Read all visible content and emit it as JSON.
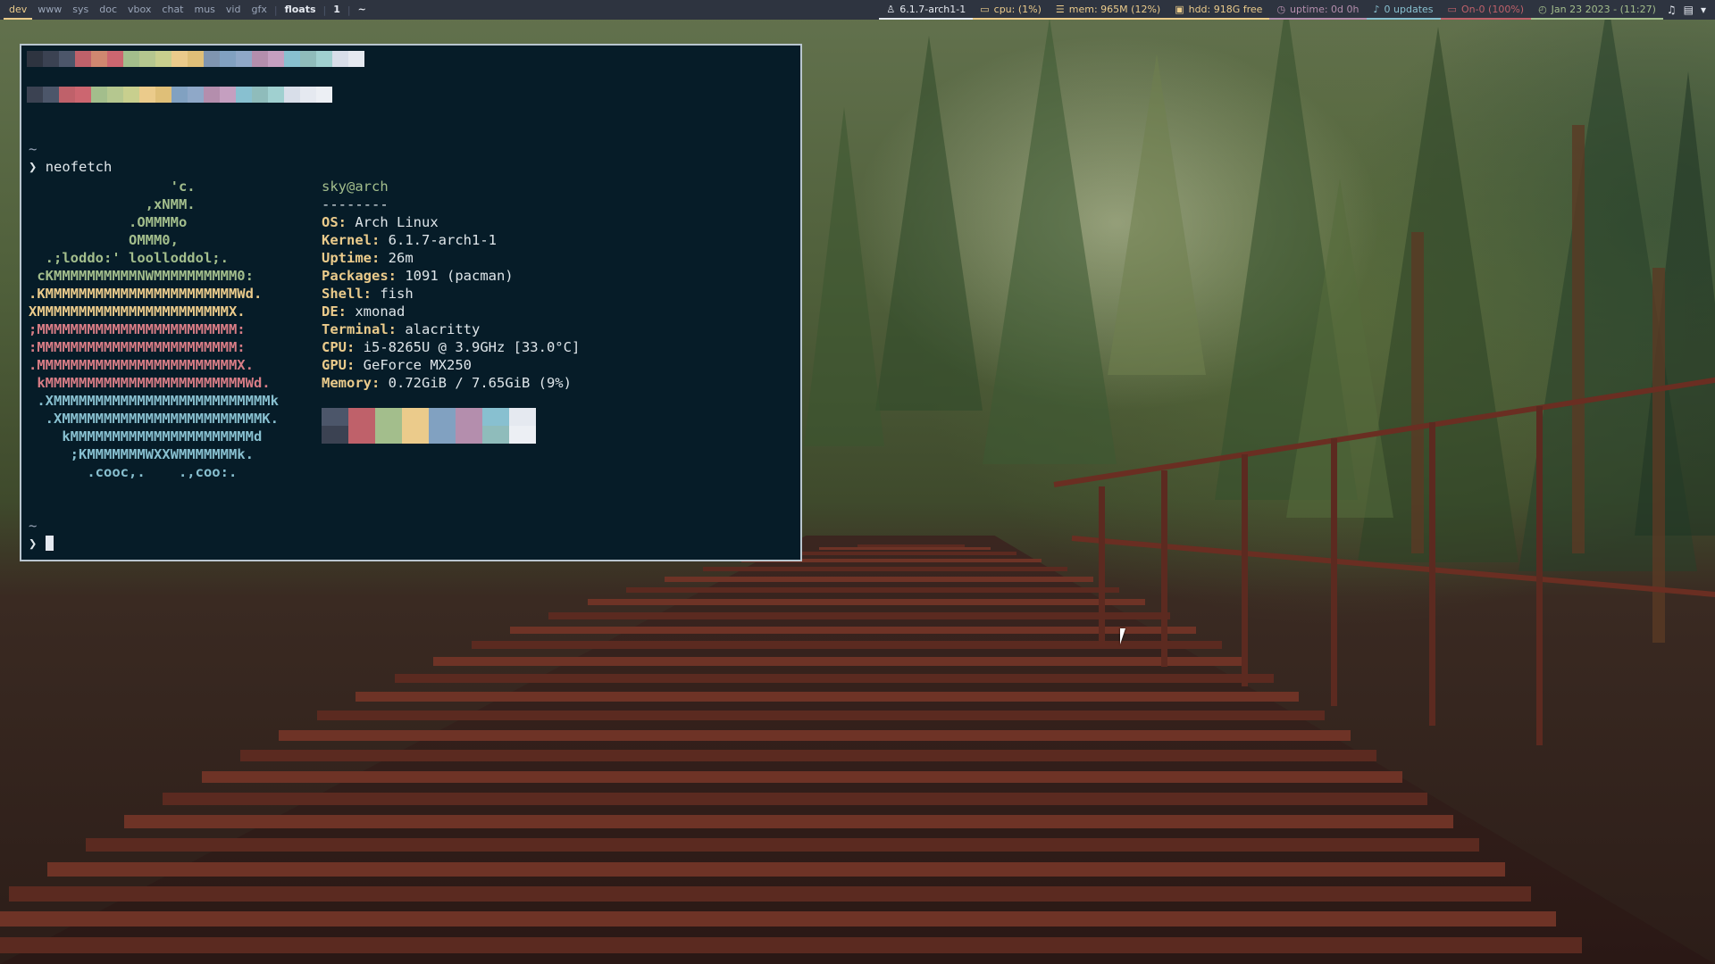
{
  "topbar": {
    "workspaces": [
      {
        "label": "dev",
        "state": "active"
      },
      {
        "label": "www",
        "state": "normal"
      },
      {
        "label": "sys",
        "state": "normal"
      },
      {
        "label": "doc",
        "state": "normal"
      },
      {
        "label": "vbox",
        "state": "normal"
      },
      {
        "label": "chat",
        "state": "normal"
      },
      {
        "label": "mus",
        "state": "normal"
      },
      {
        "label": "vid",
        "state": "normal"
      },
      {
        "label": "gfx",
        "state": "normal"
      }
    ],
    "layout": "floats",
    "window_count": "1",
    "title": "~",
    "status": [
      {
        "name": "kernel",
        "icon": "linux-icon",
        "glyph": "♙",
        "text": "6.1.7-arch1-1",
        "color": "#e5e9f0"
      },
      {
        "name": "cpu",
        "icon": "monitor-icon",
        "glyph": "▭",
        "text": "cpu: (1%)",
        "color": "#ebcb8b"
      },
      {
        "name": "mem",
        "icon": "memory-icon",
        "glyph": "☰",
        "text": "mem: 965M (12%)",
        "color": "#ebcb8b"
      },
      {
        "name": "hdd",
        "icon": "disk-icon",
        "glyph": "▣",
        "text": "hdd: 918G free",
        "color": "#ebcb8b"
      },
      {
        "name": "uptime",
        "icon": "uptime-icon",
        "glyph": "◷",
        "text": "uptime: 0d 0h",
        "color": "#b48ead"
      },
      {
        "name": "updates",
        "icon": "bell-icon",
        "glyph": "♪",
        "text": "0 updates",
        "color": "#88c0d0"
      },
      {
        "name": "battery",
        "icon": "battery-icon",
        "glyph": "▭",
        "text": "On-0 (100%)",
        "color": "#bf616a"
      },
      {
        "name": "clock",
        "icon": "clock-icon",
        "glyph": "◴",
        "text": "Jan 23 2023 - (11:27)",
        "color": "#a3be8c"
      }
    ],
    "tray": [
      {
        "name": "volume-icon",
        "glyph": "♫"
      },
      {
        "name": "clipboard-icon",
        "glyph": "▤"
      },
      {
        "name": "network-icon",
        "glyph": "▾"
      }
    ]
  },
  "terminal": {
    "colors_top": [
      "#2e3440",
      "#3b4252",
      "#4c566a",
      "#bf616a",
      "#d08770",
      "#cc6670",
      "#a3be8c",
      "#b5c78f",
      "#c8cf8e",
      "#ebcb8b",
      "#dfbf78",
      "#7f95b0",
      "#81a1c1",
      "#8fa8c8",
      "#b48ead",
      "#c59fc0",
      "#88c0d0",
      "#8fbcbb",
      "#a0d0d0",
      "#d8dee9",
      "#e5e9f0"
    ],
    "colors_bottom": [
      "#3b4252",
      "#4c566a",
      "#bf616a",
      "#cc6670",
      "#a3be8c",
      "#b5c78f",
      "#c8cf8e",
      "#ebcb8b",
      "#dfbf78",
      "#81a1c1",
      "#8fa8c8",
      "#b48ead",
      "#c59fc0",
      "#88c0d0",
      "#8fbcbb",
      "#a0d0d0",
      "#d8dee9",
      "#e5e9f0",
      "#eceff4"
    ],
    "prompt_dir_1": "~",
    "prompt_symbol": "❯",
    "command": "neofetch",
    "ascii": [
      {
        "text": "                 'c.",
        "cls": "a1"
      },
      {
        "text": "              ,xNMM.",
        "cls": "a1"
      },
      {
        "text": "            .OMMMMo",
        "cls": "a1"
      },
      {
        "text": "            OMMM0,",
        "cls": "a1"
      },
      {
        "text": "  .;loddo:' loolloddol;.",
        "cls": "a1"
      },
      {
        "text": " cKMMMMMMMMMMNWMMMMMMMMMM0:",
        "cls": "a1"
      },
      {
        "text": ".KMMMMMMMMMMMMMMMMMMMMMMMWd.",
        "cls": "a2"
      },
      {
        "text": "XMMMMMMMMMMMMMMMMMMMMMMMX.",
        "cls": "a2"
      },
      {
        "text": ";MMMMMMMMMMMMMMMMMMMMMMMM:",
        "cls": "a3"
      },
      {
        "text": ":MMMMMMMMMMMMMMMMMMMMMMMM:",
        "cls": "a3"
      },
      {
        "text": ".MMMMMMMMMMMMMMMMMMMMMMMMX.",
        "cls": "a3"
      },
      {
        "text": " kMMMMMMMMMMMMMMMMMMMMMMMMWd.",
        "cls": "a3"
      },
      {
        "text": " .XMMMMMMMMMMMMMMMMMMMMMMMMMMk",
        "cls": "a4"
      },
      {
        "text": "  .XMMMMMMMMMMMMMMMMMMMMMMMMK.",
        "cls": "a4"
      },
      {
        "text": "    kMMMMMMMMMMMMMMMMMMMMMMd",
        "cls": "a4"
      },
      {
        "text": "     ;KMMMMMMMWXXWMMMMMMMk.",
        "cls": "a4"
      },
      {
        "text": "       .cooc,.    .,coo:.",
        "cls": "a4"
      }
    ],
    "user_host": "sky@arch",
    "underline": "--------",
    "info": [
      {
        "key": "OS",
        "value": "Arch Linux"
      },
      {
        "key": "Kernel",
        "value": "6.1.7-arch1-1"
      },
      {
        "key": "Uptime",
        "value": "26m"
      },
      {
        "key": "Packages",
        "value": "1091 (pacman)"
      },
      {
        "key": "Shell",
        "value": "fish"
      },
      {
        "key": "DE",
        "value": "xmonad"
      },
      {
        "key": "Terminal",
        "value": "alacritty"
      },
      {
        "key": "CPU",
        "value": "i5-8265U @ 3.9GHz [33.0°C]"
      },
      {
        "key": "GPU",
        "value": "GeForce MX250"
      },
      {
        "key": "Memory",
        "value": "0.72GiB / 7.65GiB (9%)"
      }
    ],
    "swatch_top": [
      "#4c566a",
      "#bf616a",
      "#a3be8c",
      "#ebcb8b",
      "#81a1c1",
      "#b48ead",
      "#88c0d0",
      "#e5e9f0"
    ],
    "swatch_bottom": [
      "#3b4252",
      "#bf616a",
      "#a3be8c",
      "#ebcb8b",
      "#81a1c1",
      "#b48ead",
      "#8fbcbb",
      "#eceff4"
    ],
    "prompt_dir_2": "~"
  }
}
